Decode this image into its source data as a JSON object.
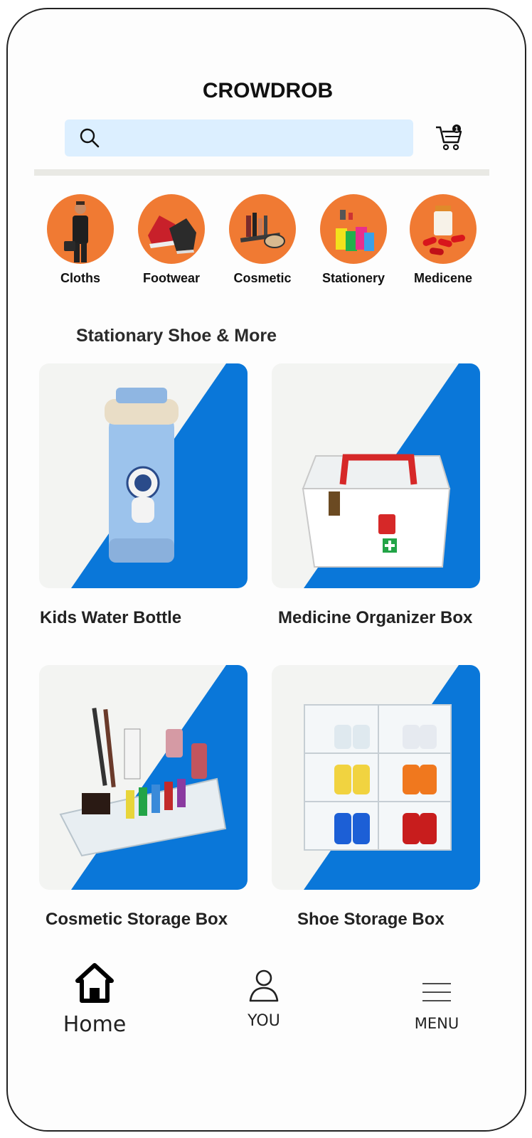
{
  "header": {
    "logo_text": "CROWDROB"
  },
  "search": {
    "placeholder": "",
    "value": ""
  },
  "cart": {
    "badge_count": "1"
  },
  "categories": [
    {
      "label": "Cloths"
    },
    {
      "label": "Footwear"
    },
    {
      "label": "Cosmetic"
    },
    {
      "label": "Stationery"
    },
    {
      "label": "Medicene"
    }
  ],
  "section": {
    "title": "Stationary Shoe & More"
  },
  "products": [
    {
      "title": "Kids  Water Bottle"
    },
    {
      "title": "Medicine Organizer Box"
    },
    {
      "title": "Cosmetic Storage Box"
    },
    {
      "title": "Shoe Storage Box"
    }
  ],
  "tabs": [
    {
      "label": "Home"
    },
    {
      "label": "YOU"
    },
    {
      "label": "MENU"
    }
  ],
  "colors": {
    "accent_orange": "#f07a33",
    "card_blue": "#0a77d9",
    "search_bg": "#dcefff"
  }
}
